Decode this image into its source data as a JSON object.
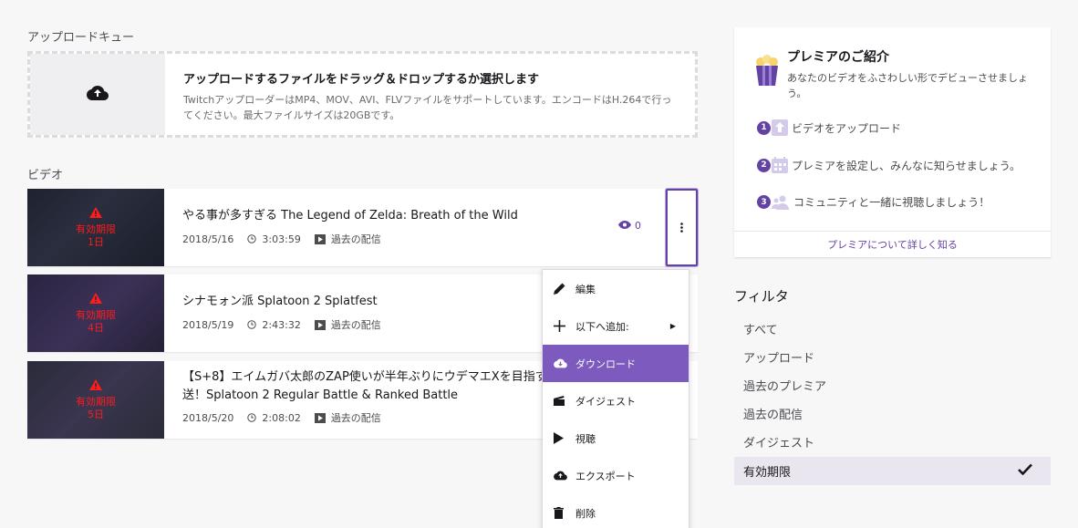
{
  "upload_queue": {
    "heading": "アップロードキュー",
    "title": "アップロードするファイルをドラッグ＆ドロップするか選択します",
    "description": "TwitchアップローダーはMP4、MOV、AVI、FLVファイルをサポートしています。エンコードはH.264で行ってください。最大ファイルサイズは20GBです。"
  },
  "videos": {
    "heading": "ビデオ",
    "items": [
      {
        "expiry_label": "有効期限",
        "expiry_days": "1日",
        "title": "やる事が多すぎる The Legend of Zelda: Breath of the Wild",
        "date": "2018/5/16",
        "duration": "3:03:59",
        "type": "過去の配信",
        "views": "0"
      },
      {
        "expiry_label": "有効期限",
        "expiry_days": "4日",
        "title": "シナモォン派 Splatoon 2 Splatfest",
        "date": "2018/5/19",
        "duration": "2:43:32",
        "type": "過去の配信",
        "views": ""
      },
      {
        "expiry_label": "有効期限",
        "expiry_days": "5日",
        "title_line1": "【S+8】エイムガバ太郎のZAP使いが半年ぶりにウデマエXを目指す",
        "title_line2": "送！Splatoon 2 Regular Battle & Ranked Battle",
        "date": "2018/5/20",
        "duration": "2:08:02",
        "type": "過去の配信",
        "views": ""
      }
    ]
  },
  "context_menu": {
    "items": [
      {
        "label": "編集",
        "icon": "pencil-icon"
      },
      {
        "label": "以下へ追加:",
        "icon": "plus-icon"
      },
      {
        "label": "ダウンロード",
        "icon": "download-icon"
      },
      {
        "label": "ダイジェスト",
        "icon": "clapper-icon"
      },
      {
        "label": "視聴",
        "icon": "play-icon"
      },
      {
        "label": "エクスポート",
        "icon": "upload-icon"
      },
      {
        "label": "削除",
        "icon": "trash-icon"
      }
    ]
  },
  "premiere_card": {
    "title": "プレミアのご紹介",
    "subtitle": "あなたのビデオをふさわしい形でデビューさせましょう。",
    "steps": [
      {
        "num": "1",
        "text": "ビデオをアップロード"
      },
      {
        "num": "2",
        "text": "プレミアを設定し、みんなに知らせましょう。"
      },
      {
        "num": "3",
        "text": "コミュニティと一緒に視聴しましょう！"
      }
    ],
    "link": "プレミアについて詳しく知る"
  },
  "filter": {
    "heading": "フィルタ",
    "items": [
      "すべて",
      "アップロード",
      "過去のプレミア",
      "過去の配信",
      "ダイジェスト",
      "有効期限"
    ],
    "selected_index": 5
  },
  "colors": {
    "accent": "#6441a4",
    "menu_active": "#7d5bbe",
    "expiry_red": "#ff1c1c"
  }
}
